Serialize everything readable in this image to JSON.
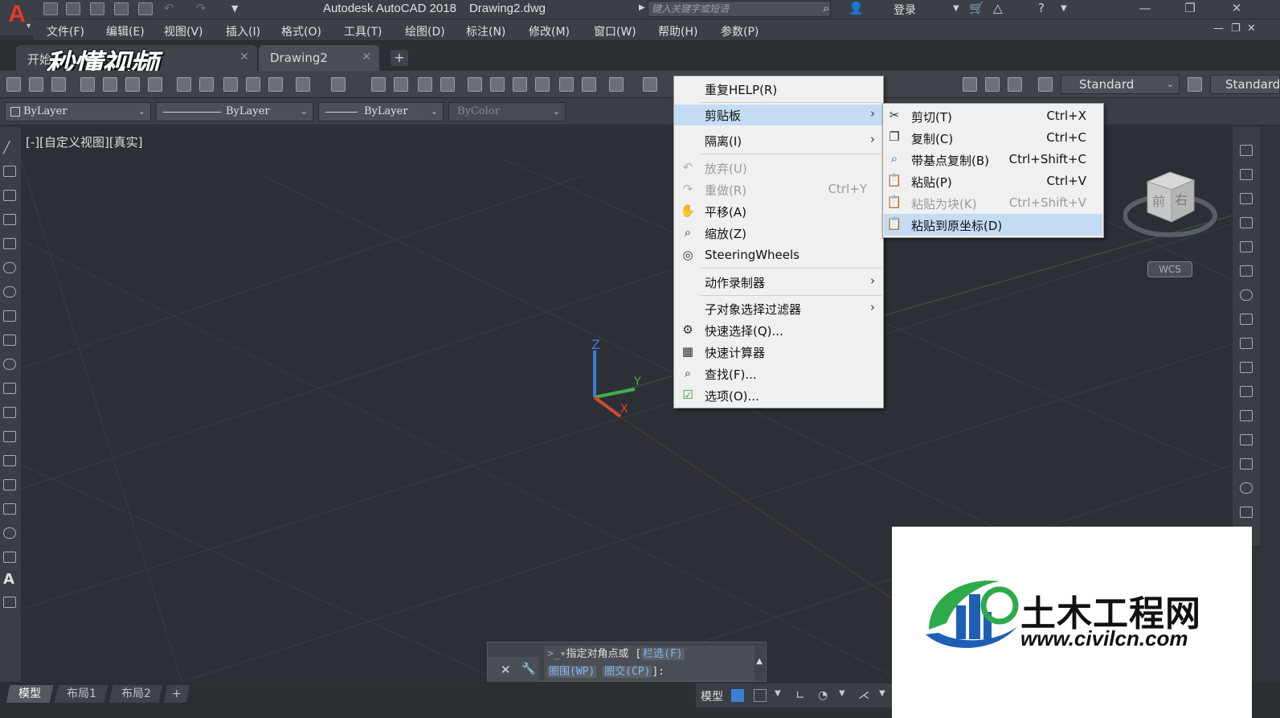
{
  "title_bar": {
    "app_name": "Autodesk AutoCAD 2018",
    "file_name": "Drawing2.dwg",
    "search_placeholder": "键入关键字或短语",
    "login_label": "登录"
  },
  "menu_bar": {
    "items": [
      "文件(F)",
      "编辑(E)",
      "视图(V)",
      "插入(I)",
      "格式(O)",
      "工具(T)",
      "绘图(D)",
      "标注(N)",
      "修改(M)",
      "窗口(W)",
      "帮助(H)",
      "参数(P)"
    ]
  },
  "tabs": {
    "start_label": "开始",
    "active_label": "Drawing2",
    "add_label": "+"
  },
  "watermark_text": "秒懂视频",
  "toolbar": {
    "text_style": "Standard",
    "dim_style": "Standard"
  },
  "properties": {
    "color": "ByLayer",
    "linetype": "ByLayer",
    "lineweight": "ByLayer",
    "plot_style": "ByColor"
  },
  "viewport_label": "[-][自定义视图][真实]",
  "context_menu": {
    "items": [
      {
        "label": "重复HELP(R)",
        "shortcut": "",
        "icon": "",
        "submenu": false,
        "disabled": false,
        "highlighted": false
      },
      {
        "label": "剪贴板",
        "shortcut": "",
        "icon": "",
        "submenu": true,
        "disabled": false,
        "highlighted": true
      },
      {
        "label": "隔离(I)",
        "shortcut": "",
        "icon": "",
        "submenu": true,
        "disabled": false,
        "highlighted": false
      },
      {
        "label": "放弃(U)",
        "shortcut": "",
        "icon": "undo-icon",
        "submenu": false,
        "disabled": true,
        "highlighted": false
      },
      {
        "label": "重做(R)",
        "shortcut": "Ctrl+Y",
        "icon": "redo-icon",
        "submenu": false,
        "disabled": true,
        "highlighted": false
      },
      {
        "label": "平移(A)",
        "shortcut": "",
        "icon": "pan-icon",
        "submenu": false,
        "disabled": false,
        "highlighted": false
      },
      {
        "label": "缩放(Z)",
        "shortcut": "",
        "icon": "zoom-icon",
        "submenu": false,
        "disabled": false,
        "highlighted": false
      },
      {
        "label": "SteeringWheels",
        "shortcut": "",
        "icon": "steering-wheel-icon",
        "submenu": false,
        "disabled": false,
        "highlighted": false
      },
      {
        "label": "动作录制器",
        "shortcut": "",
        "icon": "",
        "submenu": true,
        "disabled": false,
        "highlighted": false
      },
      {
        "label": "子对象选择过滤器",
        "shortcut": "",
        "icon": "",
        "submenu": true,
        "disabled": false,
        "highlighted": false
      },
      {
        "label": "快速选择(Q)...",
        "shortcut": "",
        "icon": "quick-select-icon",
        "submenu": false,
        "disabled": false,
        "highlighted": false
      },
      {
        "label": "快速计算器",
        "shortcut": "",
        "icon": "calculator-icon",
        "submenu": false,
        "disabled": false,
        "highlighted": false
      },
      {
        "label": "查找(F)...",
        "shortcut": "",
        "icon": "find-icon",
        "submenu": false,
        "disabled": false,
        "highlighted": false
      },
      {
        "label": "选项(O)...",
        "shortcut": "",
        "icon": "options-icon",
        "submenu": false,
        "disabled": false,
        "highlighted": false
      }
    ]
  },
  "clipboard_submenu": {
    "items": [
      {
        "label": "剪切(T)",
        "shortcut": "Ctrl+X",
        "icon": "scissors-icon",
        "disabled": false,
        "highlighted": false
      },
      {
        "label": "复制(C)",
        "shortcut": "Ctrl+C",
        "icon": "copy-icon",
        "disabled": false,
        "highlighted": false
      },
      {
        "label": "带基点复制(B)",
        "shortcut": "Ctrl+Shift+C",
        "icon": "copy-base-point-icon",
        "disabled": false,
        "highlighted": false
      },
      {
        "label": "粘贴(P)",
        "shortcut": "Ctrl+V",
        "icon": "paste-icon",
        "disabled": false,
        "highlighted": false
      },
      {
        "label": "粘贴为块(K)",
        "shortcut": "Ctrl+Shift+V",
        "icon": "paste-block-icon",
        "disabled": true,
        "highlighted": false
      },
      {
        "label": "粘贴到原坐标(D)",
        "shortcut": "",
        "icon": "paste-original-coords-icon",
        "disabled": false,
        "highlighted": true
      }
    ]
  },
  "viewcube": {
    "front_label": "前",
    "right_label": "右",
    "wcs_label": "WCS"
  },
  "axis_labels": {
    "z": "Z",
    "y": "Y",
    "x": "X"
  },
  "command_line": {
    "prompt_text": "指定对角点或",
    "kw1": "栏选(F)",
    "kw2": "圈围(WP)",
    "kw3": "圈交(CP)",
    "end": "]:"
  },
  "layout_tabs": [
    "模型",
    "布局1",
    "布局2",
    "+"
  ],
  "status_bar": {
    "model_label": "模型"
  },
  "logo": {
    "cn_text": "土木工程网",
    "url_text": "www.civilcn.com"
  },
  "colors": {
    "menu_highlight": "#c4dcf3",
    "bg_dark": "#2c3036",
    "logo_blue": "#1e5fb4",
    "logo_green": "#2eaa4a"
  }
}
